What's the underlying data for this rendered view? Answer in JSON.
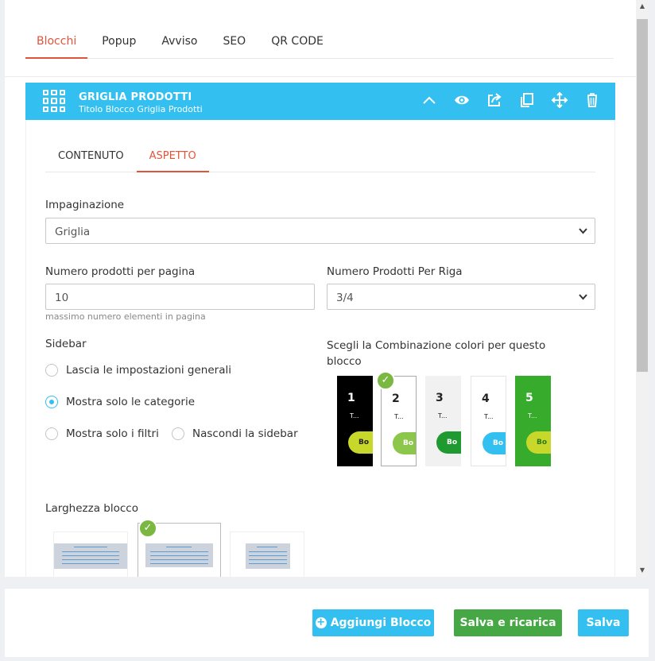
{
  "top_tabs": [
    "Blocchi",
    "Popup",
    "Avviso",
    "SEO",
    "QR CODE"
  ],
  "block": {
    "title": "GRIGLIA PRODOTTI",
    "subtitle": "Titolo Blocco Griglia Prodotti",
    "icons": [
      "chevron-up-icon",
      "eye-icon",
      "share-icon",
      "copy-icon",
      "move-icon",
      "trash-icon"
    ]
  },
  "sub_tabs": [
    "CONTENUTO",
    "ASPETTO"
  ],
  "form": {
    "layout_label": "Impaginazione",
    "layout_value": "Griglia",
    "per_page_label": "Numero prodotti per pagina",
    "per_page_value": "10",
    "per_page_hint": "massimo numero elementi in pagina",
    "per_row_label": "Numero Prodotti Per Riga",
    "per_row_value": "3/4",
    "sidebar_label": "Sidebar",
    "sidebar_options": [
      "Lascia le impostazioni generali",
      "Mostra solo le categorie",
      "Mostra solo i filtri",
      "Nascondi la sidebar"
    ],
    "sidebar_selected": "Mostra solo le categorie",
    "colors_label": "Scegli la Combinazione colori per questo blocco",
    "color_schemes": [
      {
        "num": "1",
        "t": "T...",
        "btn": "Bo",
        "bg": "#000000",
        "fg": "#ffffff",
        "btn_bg": "#c8d82a",
        "btn_fg": "#222222"
      },
      {
        "num": "2",
        "t": "T...",
        "btn": "Bo",
        "bg": "#ffffff",
        "fg": "#222222",
        "btn_bg": "#8cc64a",
        "btn_fg": "#ffffff"
      },
      {
        "num": "3",
        "t": "T...",
        "btn": "Bo",
        "bg": "#f1f1f1",
        "fg": "#222222",
        "btn_bg": "#1e9a30",
        "btn_fg": "#ffffff"
      },
      {
        "num": "4",
        "t": "T...",
        "btn": "Bo",
        "bg": "#ffffff",
        "fg": "#222222",
        "btn_bg": "#33bfef",
        "btn_fg": "#ffffff"
      },
      {
        "num": "5",
        "t": "T...",
        "btn": "Bo",
        "bg": "#37ab2c",
        "fg": "#ffffff",
        "btn_bg": "#c8d82a",
        "btn_fg": "#2a7a1c"
      }
    ],
    "color_selected": "2",
    "width_label": "Larghezza blocco",
    "width_selected": 1
  },
  "footer": {
    "add_label": "Aggiungi Blocco",
    "reload_label": "Salva e ricarica",
    "save_label": "Salva"
  }
}
